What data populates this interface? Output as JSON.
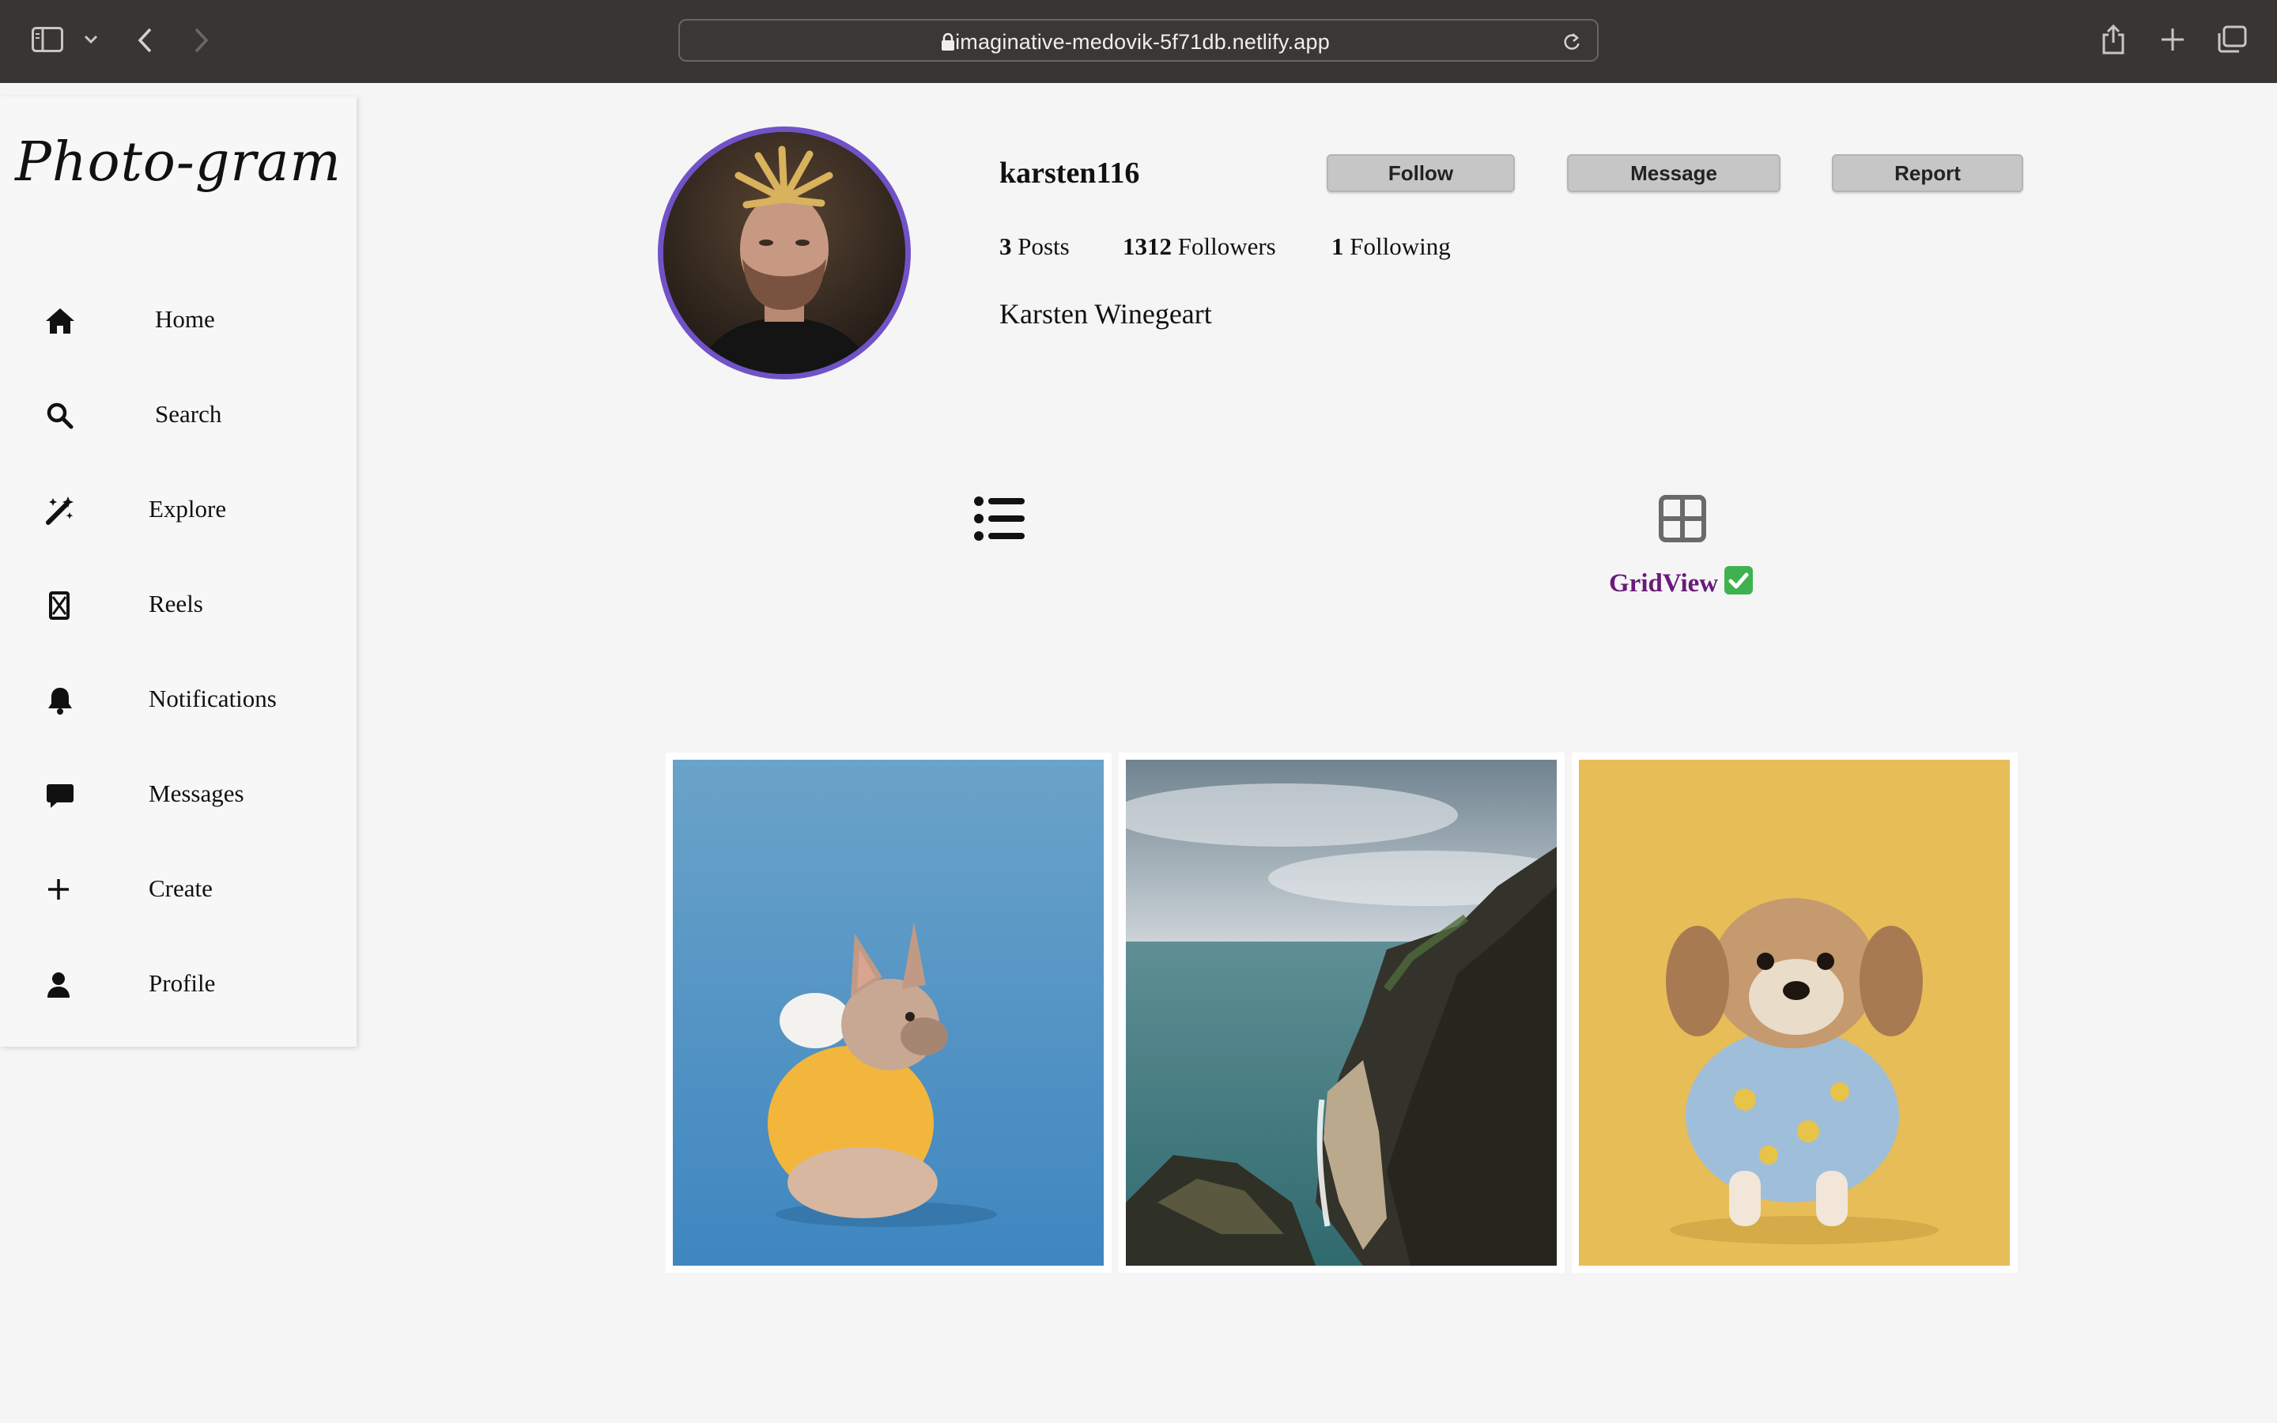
{
  "browser": {
    "url": "imaginative-medovik-5f71db.netlify.app"
  },
  "app": {
    "logo": "Photo-gram"
  },
  "sidebar": {
    "items": [
      {
        "label": "Home",
        "icon": "home-icon"
      },
      {
        "label": "Search",
        "icon": "search-icon"
      },
      {
        "label": "Explore",
        "icon": "magic-wand-icon"
      },
      {
        "label": "Reels",
        "icon": "reels-icon"
      },
      {
        "label": "Notifications",
        "icon": "bell-icon"
      },
      {
        "label": "Messages",
        "icon": "chat-bubble-icon"
      },
      {
        "label": "Create",
        "icon": "plus-icon"
      },
      {
        "label": "Profile",
        "icon": "user-icon"
      }
    ]
  },
  "profile": {
    "username": "karsten116",
    "full_name": "Karsten Winegeart",
    "posts_count": "3",
    "posts_label": "Posts",
    "followers_count": "1312",
    "followers_label": "Followers",
    "following_count": "1",
    "following_label": "Following",
    "avatar_icon": "profile-photo"
  },
  "actions": {
    "follow": "Follow",
    "message": "Message",
    "report": "Report"
  },
  "views": {
    "grid_label": "GridView",
    "grid_check": "check-mark-emoji",
    "list_icon": "list-view-icon",
    "grid_icon": "grid-view-icon"
  },
  "posts": [
    {
      "description": "french-bulldog-yellow-hoodie-blue-background"
    },
    {
      "description": "coastal-cliffs-beach-aerial"
    },
    {
      "description": "small-dog-banana-shirt-yellow-background"
    }
  ],
  "colors": {
    "chrome": "#393532",
    "avatar_ring": "#7152c7",
    "gridview_label": "#6a1a7a",
    "button_bg": "#c6c6c6"
  }
}
